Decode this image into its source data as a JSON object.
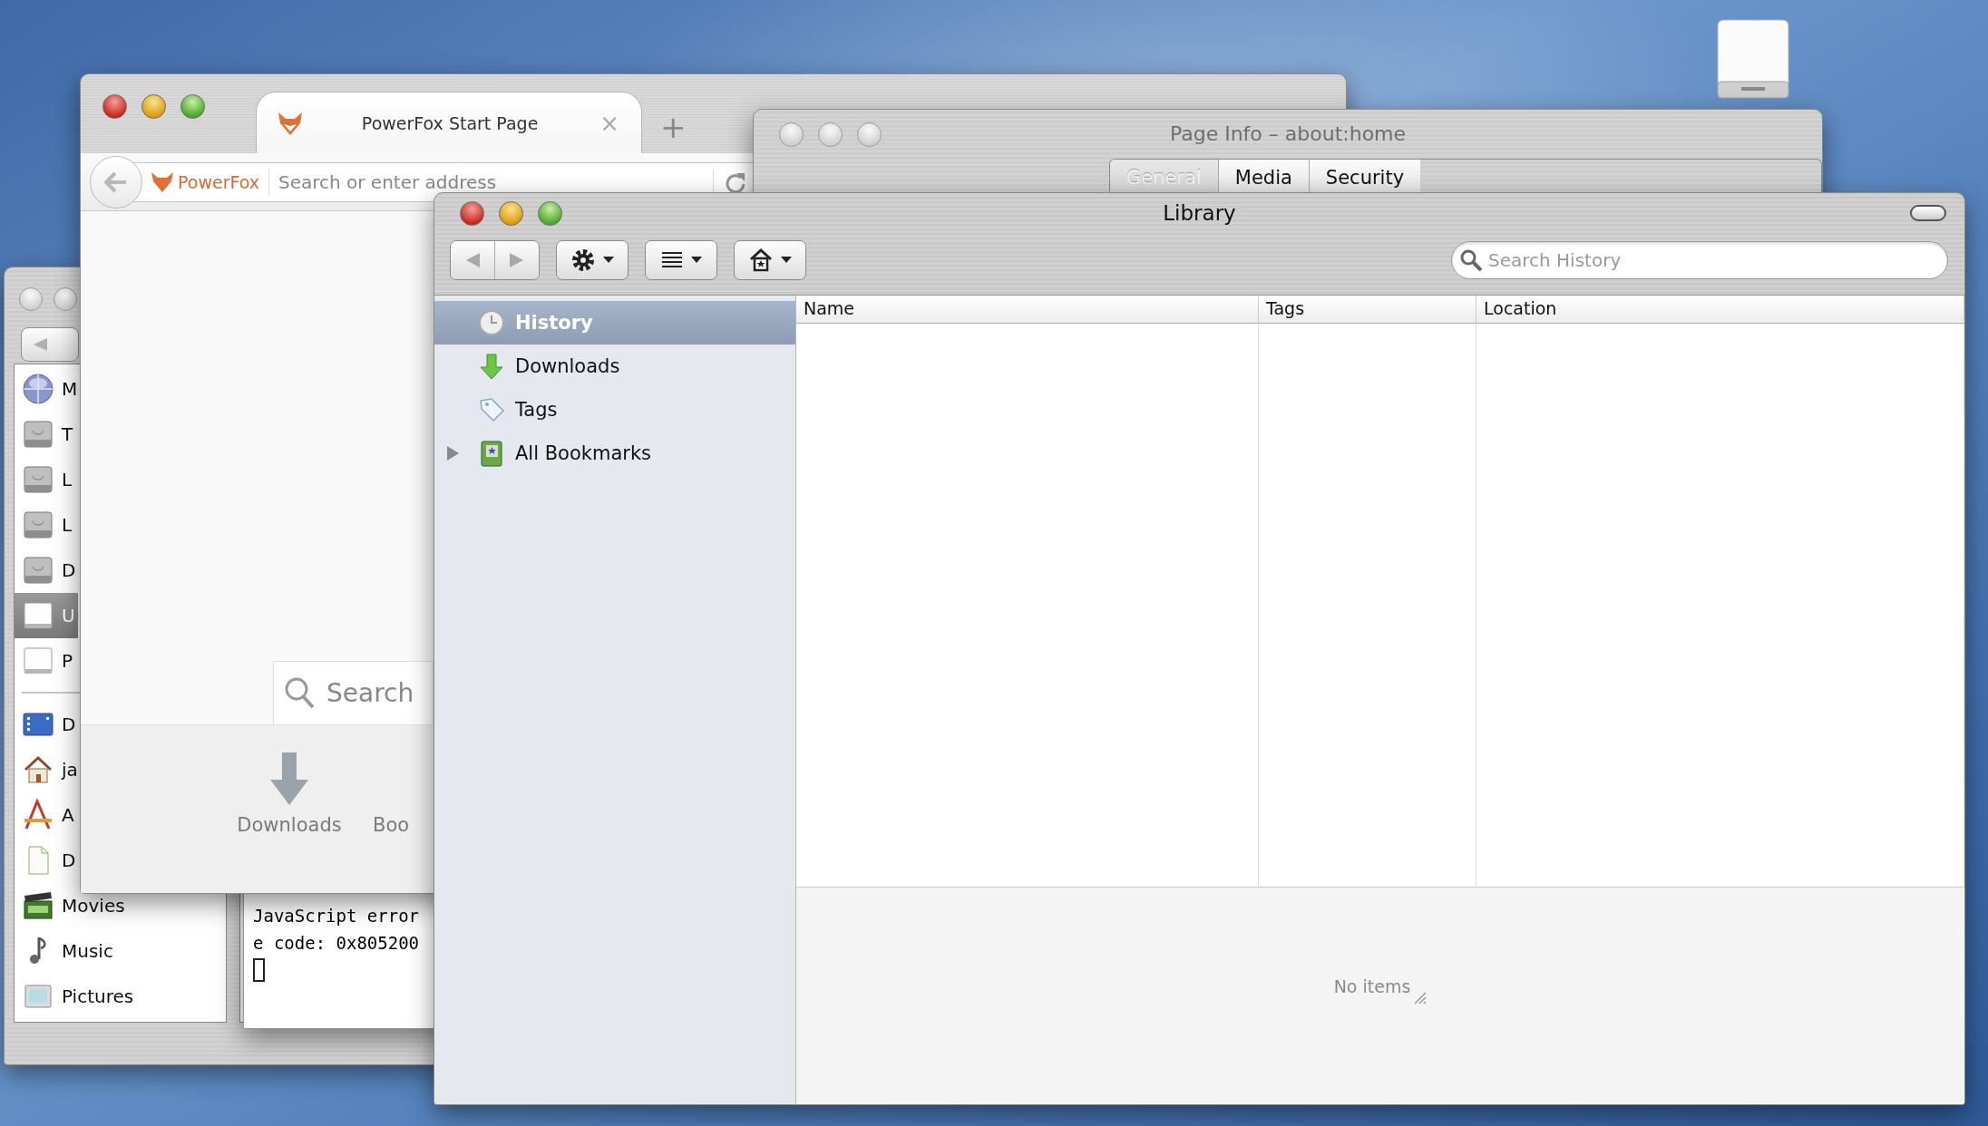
{
  "finder_window": {
    "focused": false,
    "devices": [
      {
        "label": "M",
        "kind": "network",
        "selected": false
      },
      {
        "label": "T",
        "kind": "disk",
        "selected": false
      },
      {
        "label": "L",
        "kind": "disk",
        "selected": false
      },
      {
        "label": "L",
        "kind": "disk",
        "selected": false
      },
      {
        "label": "D",
        "kind": "disk",
        "selected": false
      },
      {
        "label": "U",
        "kind": "drive",
        "selected": true
      },
      {
        "label": "P",
        "kind": "drive",
        "selected": false
      }
    ],
    "places": [
      {
        "label": "D",
        "kind": "desktop",
        "selected": false
      },
      {
        "label": "ja",
        "kind": "home",
        "selected": false
      },
      {
        "label": "A",
        "kind": "applications",
        "selected": false
      },
      {
        "label": "D",
        "kind": "documents",
        "selected": false
      },
      {
        "label": "Movies",
        "kind": "movies",
        "selected": false
      },
      {
        "label": "Music",
        "kind": "music",
        "selected": false
      },
      {
        "label": "Pictures",
        "kind": "pictures",
        "selected": false
      }
    ]
  },
  "terminal_window": {
    "lines": [
      "JavaScript error",
      "e code: 0x805200"
    ]
  },
  "browser_window": {
    "focused": true,
    "tab": {
      "title": "PowerFox Start Page",
      "close": "×"
    },
    "new_tab": "+",
    "identity": "PowerFox",
    "address_bar": {
      "placeholder": "Search or enter address"
    },
    "search_box": {
      "placeholder": "Search"
    },
    "launcher": [
      {
        "label": "Downloads",
        "kind": "downloads"
      },
      {
        "label": "Boo",
        "kind": "bookmarks"
      }
    ]
  },
  "page_info_window": {
    "focused": false,
    "title": "Page Info – about:home",
    "tabs": [
      {
        "label": "General",
        "selected": true
      },
      {
        "label": "Media",
        "selected": false
      },
      {
        "label": "Security",
        "selected": false
      }
    ]
  },
  "library_window": {
    "focused": true,
    "title": "Library",
    "search": {
      "placeholder": "Search History"
    },
    "sidebar": [
      {
        "label": "History",
        "kind": "history",
        "selected": true
      },
      {
        "label": "Downloads",
        "kind": "downloads",
        "selected": false
      },
      {
        "label": "Tags",
        "kind": "tags",
        "selected": false
      },
      {
        "label": "All Bookmarks",
        "kind": "bookmarks",
        "selected": false,
        "expanded": false
      }
    ],
    "columns": [
      "Name",
      "Tags",
      "Location"
    ],
    "details": "No items"
  }
}
